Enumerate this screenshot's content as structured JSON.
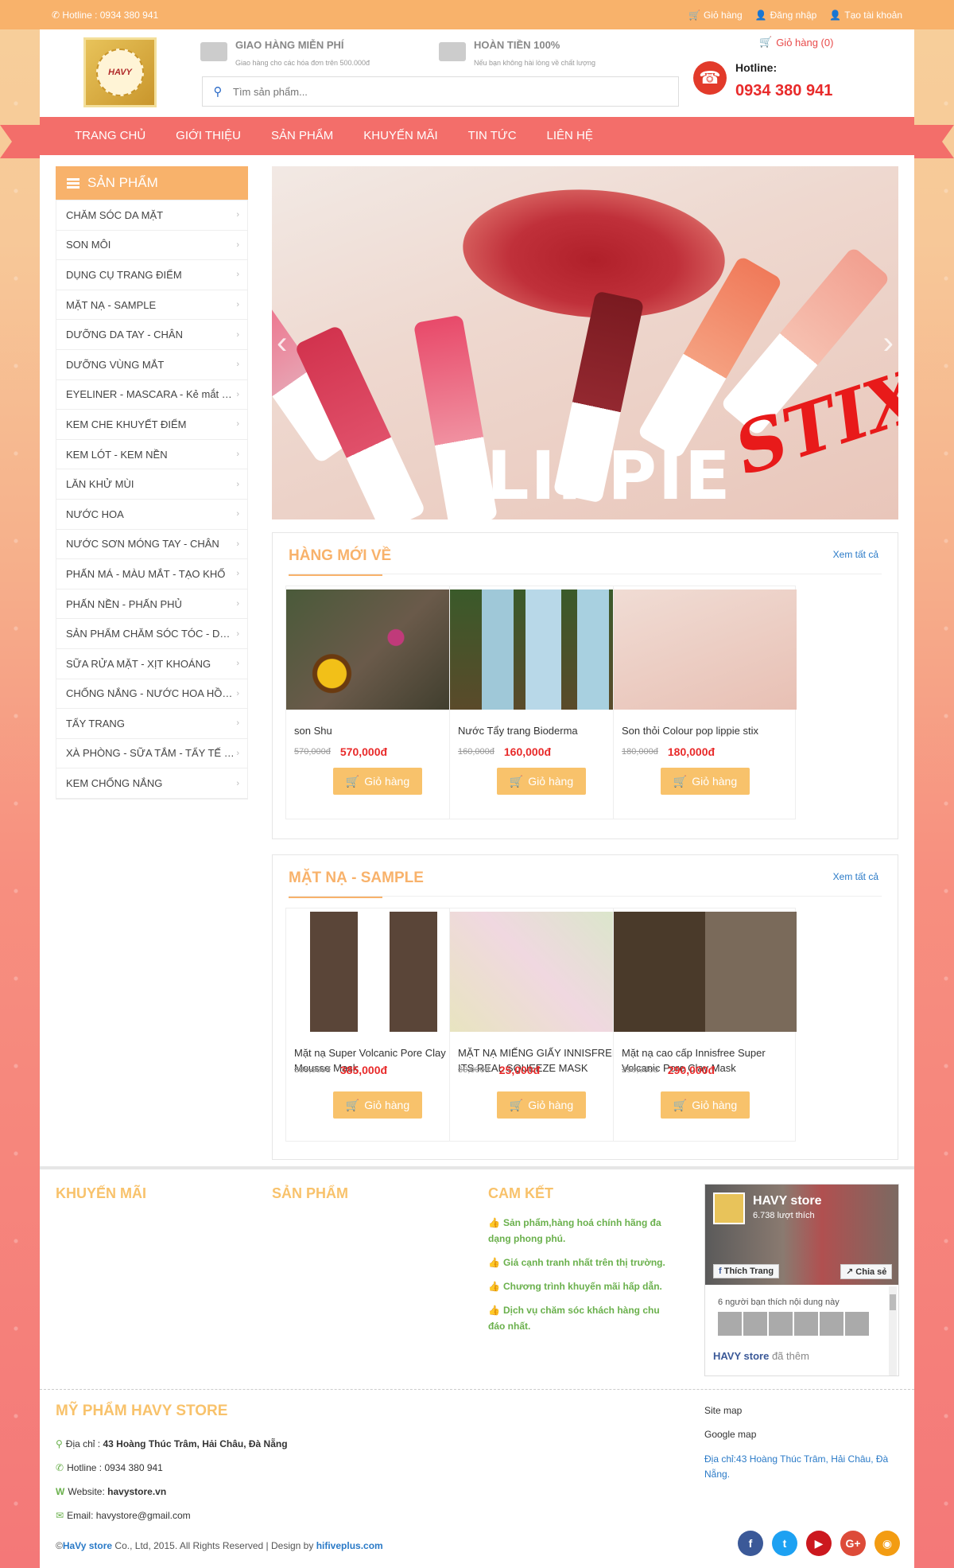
{
  "topbar": {
    "hotline": "Hotline : 0934 380 941",
    "cart": "Giỏ hàng",
    "login": "Đăng nhập",
    "register": "Tạo tài khoản"
  },
  "header": {
    "logo_text": "HAVY",
    "feature1_title": "GIAO HÀNG MIỄN PHÍ",
    "feature1_desc": "Giao hàng cho các hóa đơn trên 500.000đ",
    "feature2_title": "HOÀN TIỀN 100%",
    "feature2_desc": "Nếu bạn không hài lòng về chất lượng",
    "search_placeholder": "Tìm sản phẩm...",
    "cart_link": "Giỏ hàng (0)",
    "hotline_label": "Hotline:",
    "hotline_number": "0934 380 941"
  },
  "nav": [
    "TRANG CHỦ",
    "GIỚI THIỆU",
    "SẢN PHẨM",
    "KHUYẾN MÃI",
    "TIN TỨC",
    "LIÊN HỆ"
  ],
  "sidebar": {
    "title": "SẢN PHẨM",
    "items": [
      "CHĂM SÓC DA MẶT",
      "SON MÔI",
      "DỤNG CỤ TRANG ĐIỂM",
      "MẶT NẠ - SAMPLE",
      "DƯỠNG DA TAY - CHÂN",
      "DƯỠNG VÙNG MẮT",
      "EYELINER - MASCARA - Kẻ mắt , m...",
      "KEM CHE KHUYẾT ĐIỂM",
      "KEM LÓT - KEM NỀN",
      "LĂN KHỬ MÙI",
      "NƯỚC HOA",
      "NƯỚC SƠN MÓNG TAY - CHÂN",
      "PHẤN MÁ - MÀU MẮT - TẠO KHỐ",
      "PHẤN NỀN - PHẤN PHỦ",
      "SẢN PHẨM CHĂM SÓC TÓC - DƯ...",
      "SỮA RỬA MẶT - XỊT KHOÁNG",
      "CHỐNG NẮNG - NƯỚC HOA HỒN...",
      "TẨY TRANG",
      "XÀ PHÒNG - SỮA TẮM - TẨY TẾ B...",
      "KEM CHỐNG NẮNG"
    ]
  },
  "slider": {
    "text1": "LIPPIE",
    "text2": "STIX"
  },
  "section_new": {
    "title": "HÀNG MỚI VỀ",
    "see_all": "Xem tất cả",
    "products": [
      {
        "name": "son Shu",
        "old": "570,000đ",
        "price": "570,000đ",
        "btn": "Giỏ hàng"
      },
      {
        "name": "Nước Tẩy trang Bioderma",
        "old": "160,000đ",
        "price": "160,000đ",
        "btn": "Giỏ hàng"
      },
      {
        "name": "Son thỏi Colour pop lippie stix",
        "old": "180,000đ",
        "price": "180,000đ",
        "btn": "Giỏ hàng"
      }
    ]
  },
  "section_mask": {
    "title": "MẶT NẠ - SAMPLE",
    "see_all": "Xem tất cả",
    "products": [
      {
        "name": "Mặt nạ Super Volcanic Pore Clay Mousse Mask",
        "old": "385,000đ",
        "price": "385,000đ",
        "btn": "Giỏ hàng"
      },
      {
        "name": "MẶT NẠ MIẾNG GIẤY INNISFREE ITS REAL SQUEEZE MASK",
        "old": "30,000đ",
        "price": "25,000đ",
        "btn": "Giỏ hàng"
      },
      {
        "name": "Mặt nạ cao cấp Innisfree Super Volcanic Pore Clay Mask",
        "old": "290,000đ",
        "price": "290,000đ",
        "btn": "Giỏ hàng"
      }
    ]
  },
  "footer": {
    "col1": "KHUYẾN MÃI",
    "col2": "SẢN PHẨM",
    "col3": "CAM KẾT",
    "commitments": [
      "Sản phẩm,hàng hoá chính hãng đa dạng phong phú.",
      "Giá cạnh tranh nhất trên thị trường.",
      "Chương trình khuyến mãi hấp dẫn.",
      "Dịch vụ chăm sóc khách hàng chu đáo nhất."
    ],
    "fb_name": "HAVY store",
    "fb_likes": "6.738 lượt thích",
    "fb_like_btn": "Thích Trang",
    "fb_share_btn": "Chia sẻ",
    "fb_friends": "6 người bạn thích nội dung này",
    "fb_post_name": "HAVY store",
    "fb_post_action": "đã thêm",
    "store_title": "MỸ PHẨM HAVY STORE",
    "address_label": "Địa chỉ :",
    "address": "43 Hoàng Thúc Trâm, Hải Châu, Đà Nẵng",
    "hotline_label": "Hotline :",
    "hotline": "0934 380 941",
    "website_label": "Website:",
    "website": "havystore.vn",
    "email_label": "Email:",
    "email": "havystore@gmail.com",
    "sitemap": "Site map",
    "googlemap": "Google map",
    "address_right": "Địa chỉ:43 Hoàng Thúc Trâm, Hải Châu, Đà Nẵng.",
    "copy_prefix": "©",
    "copy_brand": "HaVy store",
    "copy_mid": " Co., Ltd, 2015. All Rights Reserved | Design by ",
    "copy_design": "hifiveplus.com"
  },
  "colors": {
    "accent": "#f8b26b",
    "nav": "#f36e6a",
    "price": "#e82a2a",
    "link": "#2a7ac7"
  },
  "icons": [
    "phone-icon",
    "cart-icon",
    "user-icon",
    "search-icon",
    "truck-icon",
    "money-icon",
    "telephone-icon",
    "list-icon",
    "chevron-right-icon",
    "thumbs-up-icon",
    "map-marker-icon",
    "envelope-icon",
    "facebook-icon",
    "twitter-icon",
    "youtube-icon",
    "google-plus-icon",
    "rss-icon"
  ]
}
